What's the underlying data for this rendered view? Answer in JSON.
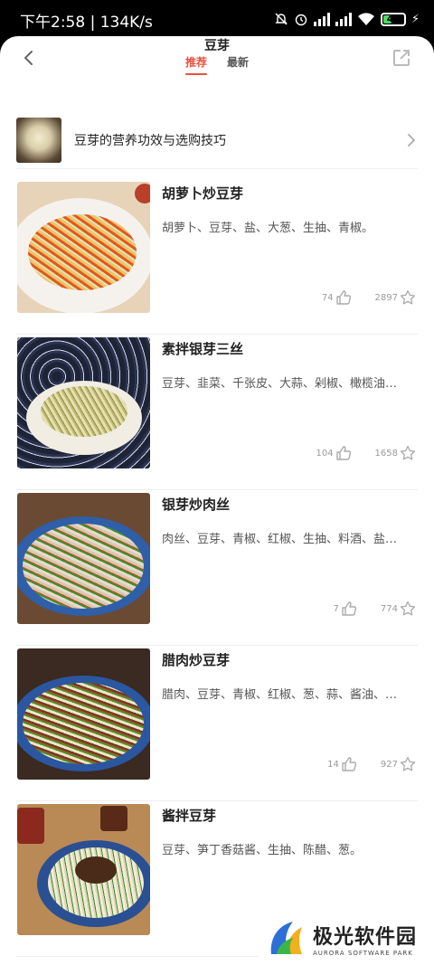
{
  "status_bar": {
    "time": "下午2:58 | 134K/s",
    "battery": "45"
  },
  "header": {
    "title": "豆芽",
    "tabs": [
      {
        "label": "推荐",
        "active": true
      },
      {
        "label": "最新",
        "active": false
      }
    ]
  },
  "banner": {
    "text": "豆芽的营养功效与选购技巧"
  },
  "recipes": [
    {
      "title": "胡萝卜炒豆芽",
      "ingredients": "胡萝卜、豆芽、盐、大葱、生抽、青椒。",
      "likes": "74",
      "favorites": "2897"
    },
    {
      "title": "素拌银芽三丝",
      "ingredients": "豆芽、韭菜、千张皮、大蒜、剁椒、橄榄油…",
      "likes": "104",
      "favorites": "1658"
    },
    {
      "title": "银芽炒肉丝",
      "ingredients": "肉丝、豆芽、青椒、红椒、生抽、料酒、盐…",
      "likes": "7",
      "favorites": "774"
    },
    {
      "title": "腊肉炒豆芽",
      "ingredients": "腊肉、豆芽、青椒、红椒、葱、蒜、酱油、…",
      "likes": "14",
      "favorites": "927"
    },
    {
      "title": "酱拌豆芽",
      "ingredients": "豆芽、笋丁香菇酱、生抽、陈醋、葱。",
      "likes": "",
      "favorites": ""
    }
  ],
  "watermark": {
    "name": "极光软件园",
    "subtitle": "AURORA SOFTWARE PARK"
  },
  "colors": {
    "accent": "#e8503e",
    "background": "#ffffff",
    "status_bar": "#000000"
  }
}
